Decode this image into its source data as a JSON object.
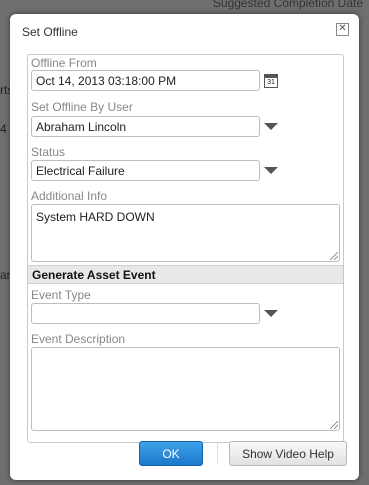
{
  "background": {
    "header_text": "Suggested Completion Date",
    "fragments": [
      "rts",
      "4 I",
      "any"
    ]
  },
  "dialog": {
    "title": "Set Offline",
    "close_glyph": "✕",
    "offline_from": {
      "label": "Offline From",
      "value": "Oct 14, 2013 03:18:00 PM",
      "calendar_glyph": "31"
    },
    "set_by_user": {
      "label": "Set Offline By User",
      "value": "Abraham Lincoln"
    },
    "status": {
      "label": "Status",
      "value": "Electrical Failure"
    },
    "additional_info": {
      "label": "Additional Info",
      "value": "System HARD DOWN"
    },
    "section_header": "Generate Asset Event",
    "event_type": {
      "label": "Event Type",
      "value": ""
    },
    "event_description": {
      "label": "Event Description",
      "value": ""
    },
    "ok_label": "OK",
    "help_label": "Show Video Help",
    "colors": {
      "ok_button": "#1b78cc",
      "label_gray": "#888888"
    }
  }
}
